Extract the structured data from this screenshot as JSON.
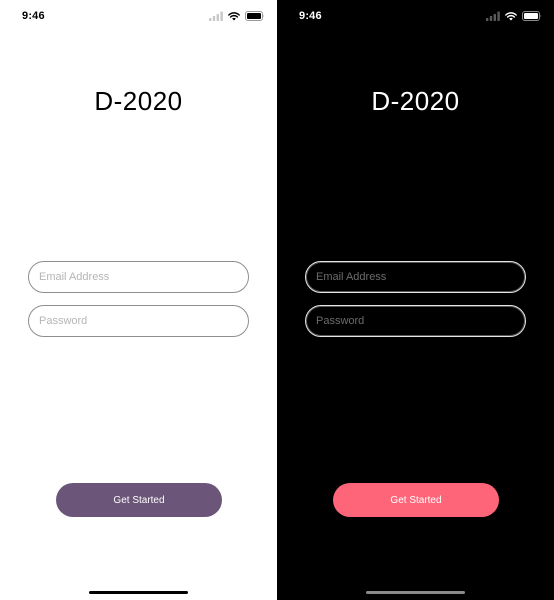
{
  "colors": {
    "light_background": "#ffffff",
    "dark_background": "#000000",
    "light_button": "#6b5578",
    "dark_button": "#ff6578"
  },
  "light_screen": {
    "status_time": "9:46",
    "title": "D-2020",
    "email_placeholder": "Email Address",
    "password_placeholder": "Password",
    "button_label": "Get Started",
    "icons": [
      "signal-icon",
      "wifi-icon",
      "battery-icon"
    ]
  },
  "dark_screen": {
    "status_time": "9:46",
    "title": "D-2020",
    "email_placeholder": "Email Address",
    "password_placeholder": "Password",
    "button_label": "Get Started",
    "icons": [
      "signal-icon",
      "wifi-icon",
      "battery-icon"
    ]
  }
}
